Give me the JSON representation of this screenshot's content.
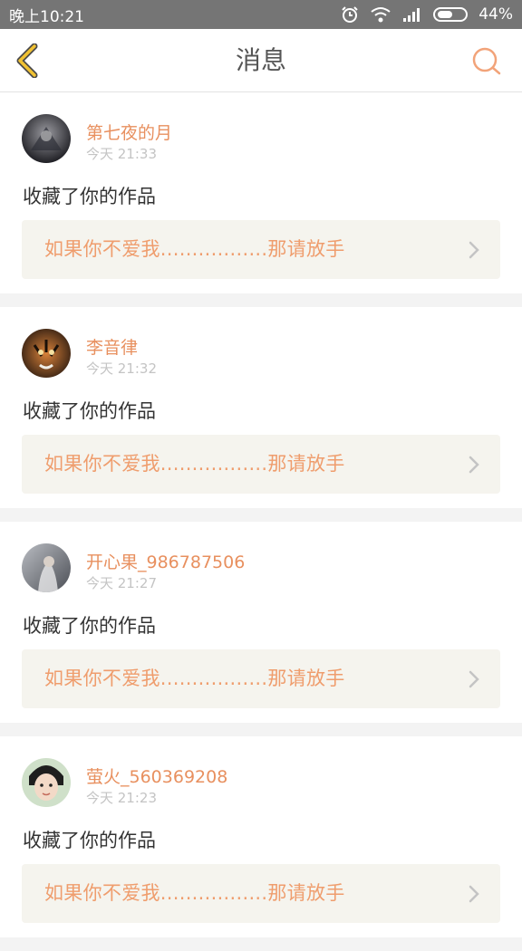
{
  "status": {
    "time": "晚上10:21",
    "battery": "44%",
    "icons": [
      "alarm-icon",
      "wifi-icon",
      "signal-icon",
      "battery-icon"
    ]
  },
  "header": {
    "title": "消息",
    "back_icon": "chevron-left-icon",
    "search_icon": "search-icon"
  },
  "notifications": [
    {
      "user": "第七夜的月",
      "time": "今天 21:33",
      "action": "收藏了你的作品",
      "work": "如果你不爱我.................那请放手",
      "avatar_color": "#3b3b3b"
    },
    {
      "user": "李音律",
      "time": "今天 21:32",
      "action": "收藏了你的作品",
      "work": "如果你不爱我.................那请放手",
      "avatar_color": "#5b3a1e"
    },
    {
      "user": "开心果_986787506",
      "time": "今天 21:27",
      "action": "收藏了你的作品",
      "work": "如果你不爱我.................那请放手",
      "avatar_color": "#8d8f92"
    },
    {
      "user": "萤火_560369208",
      "time": "今天 21:23",
      "action": "收藏了你的作品",
      "work": "如果你不爱我.................那请放手",
      "avatar_color": "#6b8a6b"
    }
  ],
  "colors": {
    "accent": "#ef9d6d",
    "username": "#e8905f",
    "back_icon": "#f1c232"
  }
}
